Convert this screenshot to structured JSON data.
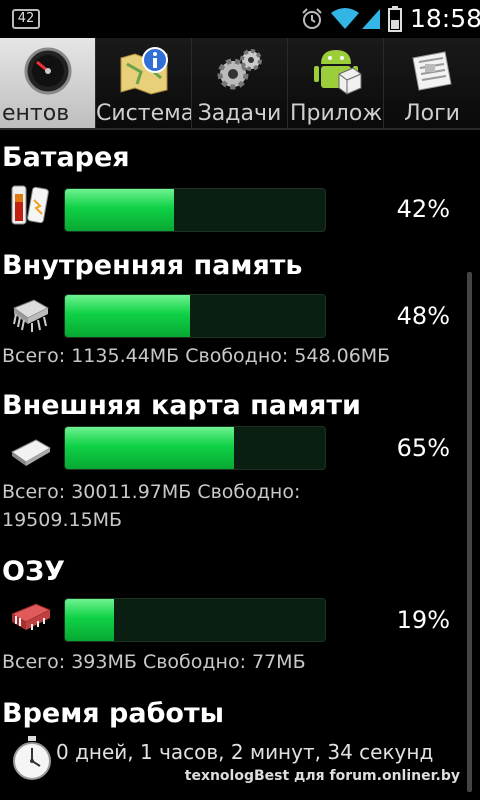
{
  "status_bar": {
    "badge": "42",
    "time": "18:58"
  },
  "tabs": [
    {
      "label": "ентов",
      "icon": "speedometer-icon",
      "active": true
    },
    {
      "label": "Система",
      "icon": "map-info-icon",
      "active": false
    },
    {
      "label": "Задачи",
      "icon": "gears-icon",
      "active": false
    },
    {
      "label": "Прилож",
      "icon": "android-icon",
      "active": false
    },
    {
      "label": "Логи",
      "icon": "newspaper-icon",
      "active": false
    }
  ],
  "sections": {
    "battery": {
      "title": "Батарея",
      "icon": "battery-icon",
      "percent_label": "42%",
      "level": 0.42
    },
    "internal": {
      "title": "Внутренняя память",
      "icon": "chip-icon",
      "percent_label": "48%",
      "level": 0.48,
      "detail": "Всего: 1135.44МБ Свободно: 548.06МБ"
    },
    "external": {
      "title": "Внешняя карта памяти",
      "icon": "sd-card-icon",
      "percent_label": "65%",
      "level": 0.65,
      "detail_line1": "Всего: 30011.97МБ Свободно:",
      "detail_line2": "19509.15МБ"
    },
    "ram": {
      "title": "ОЗУ",
      "icon": "ram-module-icon",
      "percent_label": "19%",
      "level": 0.19,
      "detail": "Всего: 393МБ Свободно: 77МБ"
    },
    "uptime": {
      "title": "Время работы",
      "icon": "stopwatch-icon",
      "value": "0 дней, 1 часов, 2 минут, 34 секунд"
    }
  },
  "watermark": "texnologBest для forum.onliner.by",
  "colors": {
    "bar_fill": "#0fd146",
    "bar_track": "#0b1e12",
    "background": "#000000"
  }
}
